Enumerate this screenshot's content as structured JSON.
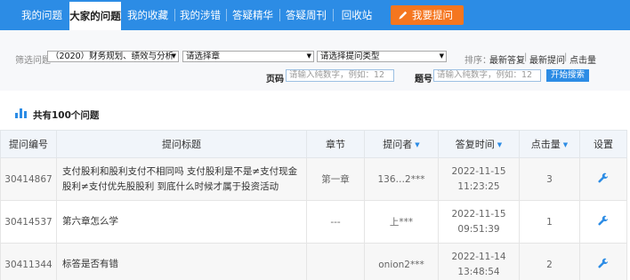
{
  "tabs": [
    "我的问题",
    "大家的问题",
    "我的收藏夹",
    "我的涉错",
    "答疑精华",
    "答疑周刊",
    "回收站"
  ],
  "ask_button": "我要提问",
  "filter": {
    "label": "筛选问题",
    "course_select": "（2020）财务规划、绩效与分析",
    "chapter_select": "请选择章",
    "type_select": "请选择提问类型",
    "sort_label": "排序：",
    "sort_options": [
      "最新答复",
      "最新提问",
      "点击量"
    ],
    "page_label": "页码",
    "page_placeholder": "请输入纯数字，例如：12",
    "question_label": "题号",
    "question_placeholder": "请输入纯数字，例如：12",
    "search_button": "开始搜索"
  },
  "count_label": "共有100个问题",
  "table": {
    "headers": [
      "提问编号",
      "提问标题",
      "章节",
      "提问者",
      "答复时间",
      "点击量",
      "设置"
    ],
    "rows": [
      {
        "id": "30414867",
        "title": "支付股利和股利支付不相同吗 支付股利是不是≠支付现金股利≠支付优先股股利 到底什么时候才属于投资活动",
        "chapter": "第一章",
        "asker": "136…2***",
        "date": "2022-11-15",
        "time": "11:23:25",
        "clicks": "3"
      },
      {
        "id": "30414537",
        "title": "第六章怎么学",
        "chapter": "---",
        "asker": "上***",
        "date": "2022-11-15",
        "time": "09:51:39",
        "clicks": "1"
      },
      {
        "id": "30411344",
        "title": "标答是否有错",
        "chapter": "",
        "asker": "onion2***",
        "date": "2022-11-14",
        "time": "13:48:54",
        "clicks": "2"
      }
    ]
  },
  "colors": {
    "primary": "#2c8ce5",
    "ask_orange": "#f5761f"
  },
  "icons": {
    "ask": "pencil-icon",
    "count": "bar-chart-icon",
    "settings": "wrench-icon"
  }
}
